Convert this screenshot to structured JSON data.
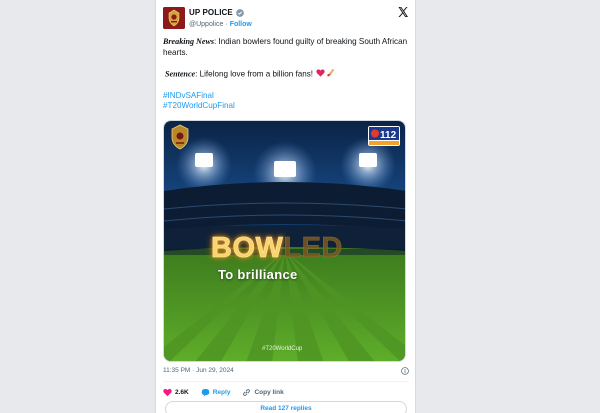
{
  "post": {
    "author_name": "UP POLICE",
    "handle": "@Uppolice",
    "separator": "·",
    "follow_label": "Follow",
    "body": {
      "line1_bold": "Breaking News",
      "line1_rest": ": Indian bowlers found guilty of breaking South African hearts.",
      "line2_bold": "Sentence",
      "line2_rest": ": Lifelong love from a billion fans!",
      "hashtags": [
        "#INDvSAFinal",
        "#T20WorldCupFinal"
      ]
    },
    "media": {
      "headline_lit": "BOW",
      "headline_dim": "LED",
      "tagline": "To brilliance",
      "hashtag": "#T20WorldCup",
      "badge_number": "112"
    },
    "timestamp": "11:35 PM · Jun 29, 2024",
    "actions": {
      "likes": "2.6K",
      "reply_label": "Reply",
      "copy_link_label": "Copy link"
    },
    "read_replies_label": "Read 127 replies"
  },
  "colors": {
    "accent": "#1d9bf0",
    "like_red": "#f91880",
    "text_primary": "#0f1419",
    "text_secondary": "#536471"
  },
  "icons": [
    "police-emblem-icon",
    "verified-badge-icon",
    "x-logo-icon",
    "heart-emoji-icon",
    "cricket-bat-emoji-icon",
    "info-icon",
    "heart-icon",
    "reply-icon",
    "link-icon"
  ]
}
